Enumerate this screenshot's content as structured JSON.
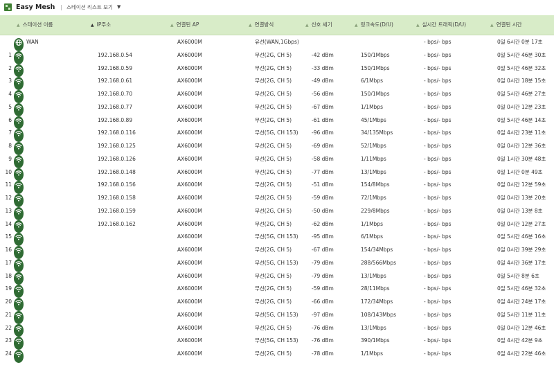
{
  "app": {
    "title": "Easy Mesh",
    "separator": "|",
    "view_label": "스테이션 리스트 보기",
    "view_caret": "▼"
  },
  "columns": {
    "station": "스테이션 이름",
    "ip": "IP주소",
    "ap": "연결된 AP",
    "conn": "연결방식",
    "signal": "신호 세기",
    "link": "링크속도(D/U)",
    "traffic": "실시간 트래픽(D/U)",
    "time": "연결된 시간"
  },
  "icons": {
    "sort": "sort-triangle-icon",
    "wifi": "wifi-icon",
    "wan": "globe-icon",
    "brand_color": "#2f6b33"
  },
  "rows": [
    {
      "num": "",
      "icon": "wan",
      "name": "WAN",
      "ip": "",
      "ap": "AX6000M",
      "conn": "유선(WAN,1Gbps)",
      "sig": "",
      "link": "",
      "traf": "- bps/- bps",
      "time": "0일 6시간 0분 17초"
    },
    {
      "num": "1",
      "icon": "wifi",
      "name": "",
      "ip": "192.168.0.54",
      "ap": "AX6000M",
      "conn": "무선(2G, CH 5)",
      "sig": "-42 dBm",
      "link": "150/1Mbps",
      "traf": "- bps/- bps",
      "time": "0일 5시간 46분 30초"
    },
    {
      "num": "2",
      "icon": "wifi",
      "name": "",
      "ip": "192.168.0.59",
      "ap": "AX6000M",
      "conn": "무선(2G, CH 5)",
      "sig": "-33 dBm",
      "link": "150/1Mbps",
      "traf": "- bps/- bps",
      "time": "0일 5시간 46분 32초"
    },
    {
      "num": "3",
      "icon": "wifi",
      "name": "",
      "ip": "192.168.0.61",
      "ap": "AX6000M",
      "conn": "무선(2G, CH 5)",
      "sig": "-49 dBm",
      "link": "6/1Mbps",
      "traf": "- bps/- bps",
      "time": "0일 0시간 18분 15초"
    },
    {
      "num": "4",
      "icon": "wifi",
      "name": "",
      "ip": "192.168.0.70",
      "ap": "AX6000M",
      "conn": "무선(2G, CH 5)",
      "sig": "-56 dBm",
      "link": "150/1Mbps",
      "traf": "- bps/- bps",
      "time": "0일 5시간 46분 27초"
    },
    {
      "num": "5",
      "icon": "wifi",
      "name": "",
      "ip": "192.168.0.77",
      "ap": "AX6000M",
      "conn": "무선(2G, CH 5)",
      "sig": "-67 dBm",
      "link": "1/1Mbps",
      "traf": "- bps/- bps",
      "time": "0일 0시간 12분 23초"
    },
    {
      "num": "6",
      "icon": "wifi",
      "name": "",
      "ip": "192.168.0.89",
      "ap": "AX6000M",
      "conn": "무선(2G, CH 5)",
      "sig": "-61 dBm",
      "link": "45/1Mbps",
      "traf": "- bps/- bps",
      "time": "0일 5시간 46분 14초"
    },
    {
      "num": "7",
      "icon": "wifi",
      "name": "",
      "ip": "192.168.0.116",
      "ap": "AX6000M",
      "conn": "무선(5G, CH 153)",
      "sig": "-96 dBm",
      "link": "34/135Mbps",
      "traf": "- bps/- bps",
      "time": "0일 4시간 23분 11초"
    },
    {
      "num": "8",
      "icon": "wifi",
      "name": "",
      "ip": "192.168.0.125",
      "ap": "AX6000M",
      "conn": "무선(2G, CH 5)",
      "sig": "-69 dBm",
      "link": "52/1Mbps",
      "traf": "- bps/- bps",
      "time": "0일 0시간 12분 36초"
    },
    {
      "num": "9",
      "icon": "wifi",
      "name": "",
      "ip": "192.168.0.126",
      "ap": "AX6000M",
      "conn": "무선(2G, CH 5)",
      "sig": "-58 dBm",
      "link": "1/11Mbps",
      "traf": "- bps/- bps",
      "time": "0일 1시간 30분 48초"
    },
    {
      "num": "10",
      "icon": "wifi",
      "name": "",
      "ip": "192.168.0.148",
      "ap": "AX6000M",
      "conn": "무선(2G, CH 5)",
      "sig": "-77 dBm",
      "link": "13/1Mbps",
      "traf": "- bps/- bps",
      "time": "0일 1시간 0분 49초"
    },
    {
      "num": "11",
      "icon": "wifi",
      "name": "",
      "ip": "192.168.0.156",
      "ap": "AX6000M",
      "conn": "무선(2G, CH 5)",
      "sig": "-51 dBm",
      "link": "154/8Mbps",
      "traf": "- bps/- bps",
      "time": "0일 0시간 12분 59초"
    },
    {
      "num": "12",
      "icon": "wifi",
      "name": "",
      "ip": "192.168.0.158",
      "ap": "AX6000M",
      "conn": "무선(2G, CH 5)",
      "sig": "-59 dBm",
      "link": "72/1Mbps",
      "traf": "- bps/- bps",
      "time": "0일 0시간 13분 20초"
    },
    {
      "num": "13",
      "icon": "wifi",
      "name": "",
      "ip": "192.168.0.159",
      "ap": "AX6000M",
      "conn": "무선(2G, CH 5)",
      "sig": "-50 dBm",
      "link": "229/8Mbps",
      "traf": "- bps/- bps",
      "time": "0일 0시간 13분 8초"
    },
    {
      "num": "14",
      "icon": "wifi",
      "name": "",
      "ip": "192.168.0.162",
      "ap": "AX6000M",
      "conn": "무선(2G, CH 5)",
      "sig": "-62 dBm",
      "link": "1/1Mbps",
      "traf": "- bps/- bps",
      "time": "0일 0시간 12분 27초"
    },
    {
      "num": "15",
      "icon": "wifi",
      "name": "",
      "ip": "",
      "ap": "AX6000M",
      "conn": "무선(5G, CH 153)",
      "sig": "-95 dBm",
      "link": "6/1Mbps",
      "traf": "- bps/- bps",
      "time": "0일 5시간 46분 16초"
    },
    {
      "num": "16",
      "icon": "wifi",
      "name": "",
      "ip": "",
      "ap": "AX6000M",
      "conn": "무선(2G, CH 5)",
      "sig": "-67 dBm",
      "link": "154/34Mbps",
      "traf": "- bps/- bps",
      "time": "0일 0시간 39분 29초"
    },
    {
      "num": "17",
      "icon": "wifi",
      "name": "",
      "ip": "",
      "ap": "AX6000M",
      "conn": "무선(5G, CH 153)",
      "sig": "-79 dBm",
      "link": "288/566Mbps",
      "traf": "- bps/- bps",
      "time": "0일 4시간 36분 17초"
    },
    {
      "num": "18",
      "icon": "wifi",
      "name": "",
      "ip": "",
      "ap": "AX6000M",
      "conn": "무선(2G, CH 5)",
      "sig": "-79 dBm",
      "link": "13/1Mbps",
      "traf": "- bps/- bps",
      "time": "0일 5시간 8분 6초"
    },
    {
      "num": "19",
      "icon": "wifi",
      "name": "",
      "ip": "",
      "ap": "AX6000M",
      "conn": "무선(2G, CH 5)",
      "sig": "-59 dBm",
      "link": "28/11Mbps",
      "traf": "- bps/- bps",
      "time": "0일 5시간 46분 32초"
    },
    {
      "num": "20",
      "icon": "wifi",
      "name": "",
      "ip": "",
      "ap": "AX6000M",
      "conn": "무선(2G, CH 5)",
      "sig": "-66 dBm",
      "link": "172/34Mbps",
      "traf": "- bps/- bps",
      "time": "0일 4시간 24분 17초"
    },
    {
      "num": "21",
      "icon": "wifi",
      "name": "",
      "ip": "",
      "ap": "AX6000M",
      "conn": "무선(5G, CH 153)",
      "sig": "-97 dBm",
      "link": "108/143Mbps",
      "traf": "- bps/- bps",
      "time": "0일 5시간 11분 11초"
    },
    {
      "num": "22",
      "icon": "wifi",
      "name": "",
      "ip": "",
      "ap": "AX6000M",
      "conn": "무선(2G, CH 5)",
      "sig": "-76 dBm",
      "link": "13/1Mbps",
      "traf": "- bps/- bps",
      "time": "0일 0시간 12분 46초"
    },
    {
      "num": "23",
      "icon": "wifi",
      "name": "",
      "ip": "",
      "ap": "AX6000M",
      "conn": "무선(5G, CH 153)",
      "sig": "-76 dBm",
      "link": "390/1Mbps",
      "traf": "- bps/- bps",
      "time": "0일 4시간 42분 9초"
    },
    {
      "num": "24",
      "icon": "wifi",
      "name": "",
      "ip": "",
      "ap": "AX6000M",
      "conn": "무선(2G, CH 5)",
      "sig": "-78 dBm",
      "link": "1/1Mbps",
      "traf": "- bps/- bps",
      "time": "0일 4시간 22분 46초"
    }
  ]
}
